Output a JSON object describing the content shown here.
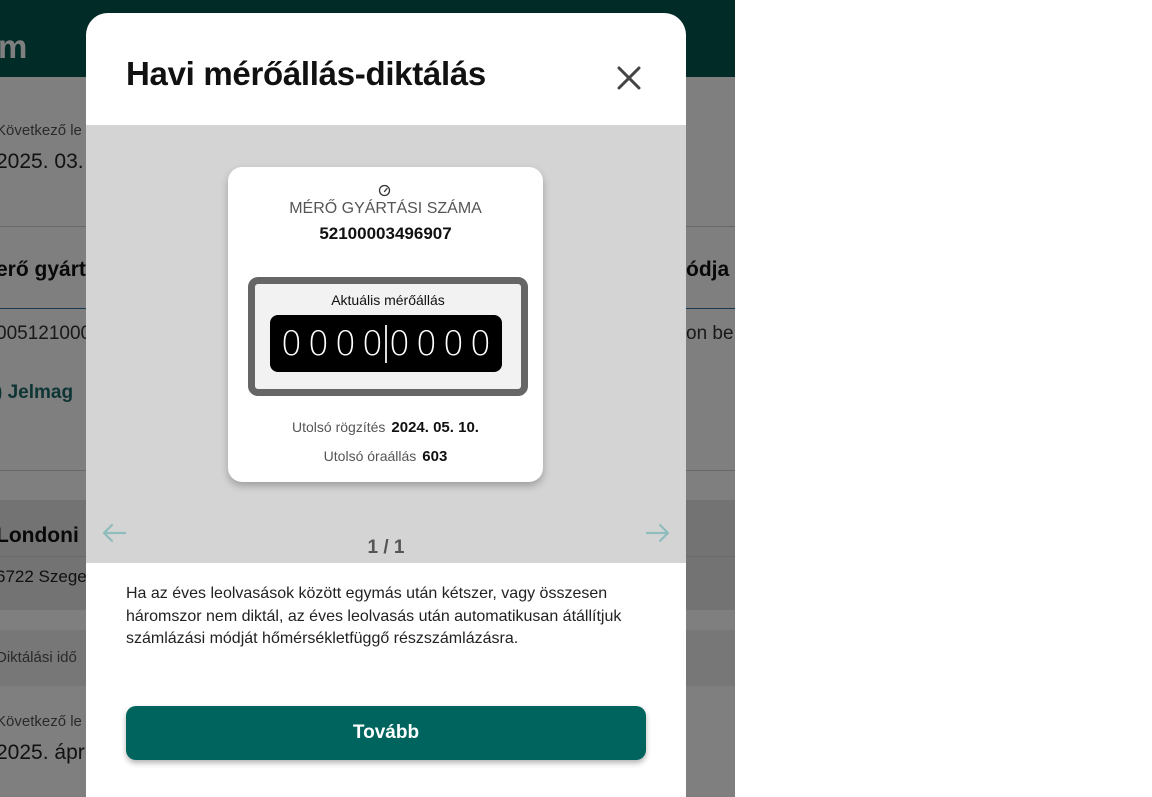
{
  "background": {
    "header_title_fragment": "m",
    "fragments": {
      "next_read_label_1": "Következő le",
      "next_read_value_1": "2025. 03.",
      "meter_serial_heading": "erő gyárt",
      "mode_heading": "ódja",
      "meter_serial_value": "005121000",
      "mode_value": "on be",
      "legend_link": ") Jelmag",
      "address_street": "Londoni",
      "address_city": "6722 Szege",
      "dictation_period": "Diktálási idő",
      "next_read_label_2": "Következő le",
      "next_read_value_2": "2025. ápr"
    }
  },
  "modal": {
    "title": "Havi mérőállás-diktálás",
    "close_icon": "close-icon",
    "meter_card": {
      "icon": "gauge-icon",
      "serial_label": "MÉRŐ GYÁRTÁSI SZÁMA",
      "serial_value": "52100003496907",
      "reading_label": "Aktuális mérőállás",
      "digits": [
        "0",
        "0",
        "0",
        "0",
        "0",
        "0",
        "0",
        "0"
      ],
      "last_record_label": "Utolsó rögzítés",
      "last_record_value": "2024. 05. 10.",
      "last_reading_label": "Utolsó óraállás",
      "last_reading_value": "603"
    },
    "pager": "1 / 1",
    "prev_icon": "arrow-left-icon",
    "next_icon": "arrow-right-icon",
    "notice": "Ha az éves leolvasások között egymás után kétszer, vagy összesen háromszor nem diktál, az éves leolvasás után automatikusan átállítjuk számlázási módját hőmérsékletfüggő részszámlázásra.",
    "next_button": "Tovább"
  },
  "colors": {
    "brand": "#00564f",
    "button": "#00645e",
    "arrow": "#8fbcbc"
  }
}
